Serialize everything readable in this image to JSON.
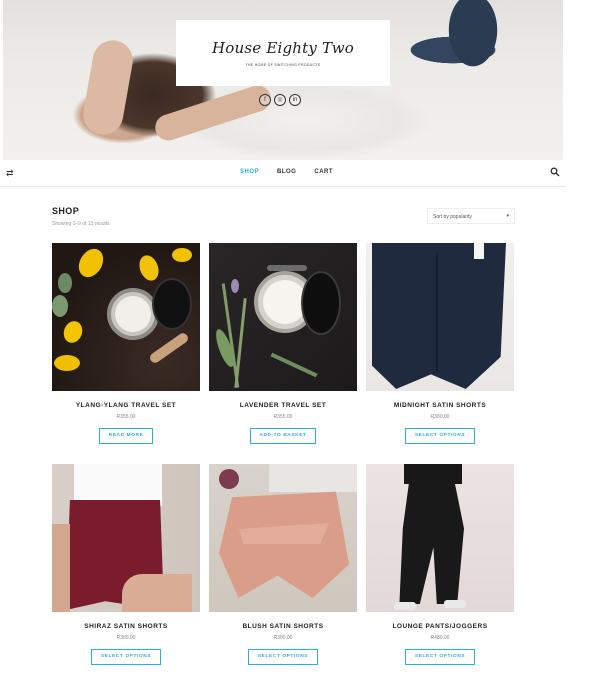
{
  "header": {
    "logo_title": "House Eighty Two",
    "logo_tagline": "THE HOME OF SWITCHING PRODUCTS",
    "socials": [
      {
        "icon": "facebook-icon",
        "glyph": "f"
      },
      {
        "icon": "instagram-icon",
        "glyph": "◎"
      },
      {
        "icon": "linkedin-icon",
        "glyph": "in"
      }
    ]
  },
  "nav": {
    "items": [
      "SHOP",
      "BLOG",
      "CART"
    ],
    "active": "SHOP",
    "separator": "·",
    "left_icon": "shuffle-icon",
    "right_icon": "search-icon"
  },
  "shop": {
    "title": "SHOP",
    "result_count": "Showing 1–9 of 13 results",
    "sort_label": "Sort by popularity",
    "sort_caret": "▾"
  },
  "products": [
    {
      "name": "YLANG-YLANG TRAVEL SET",
      "price": "R355.00",
      "button": "READ MORE"
    },
    {
      "name": "LAVENDER TRAVEL SET",
      "price": "R355.00",
      "button": "ADD TO BASKET"
    },
    {
      "name": "MIDNIGHT SATIN SHORTS",
      "price": "R380.00",
      "button": "SELECT OPTIONS"
    },
    {
      "name": "SHIRAZ SATIN SHORTS",
      "price": "R380.00",
      "button": "SELECT OPTIONS"
    },
    {
      "name": "BLUSH SATIN SHORTS",
      "price": "R380.00",
      "button": "SELECT OPTIONS"
    },
    {
      "name": "LOUNGE PANTS/JOGGERS",
      "price": "R480.00",
      "button": "SELECT OPTIONS"
    }
  ],
  "colors": {
    "accent": "#2bb0d8"
  }
}
